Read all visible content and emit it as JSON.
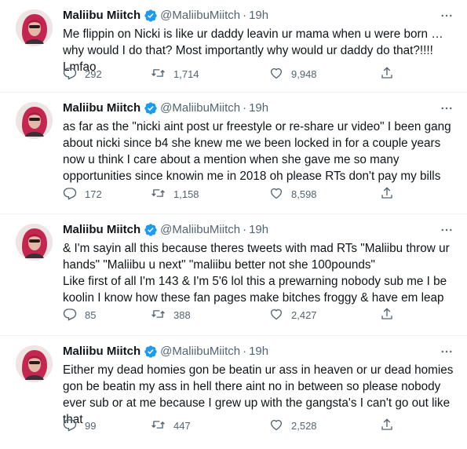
{
  "tweets": [
    {
      "name": "Maliibu Miitch",
      "handle": "@MaliibuMiitch",
      "dot": "·",
      "time": "19h",
      "text": "Me flippin on Nicki is like ur daddy leavin ur mama when u were born … why would I do that? Most importantly why would ur daddy do that?!!!! Lmfao",
      "replies": "292",
      "retweets": "1,714",
      "likes": "9,948"
    },
    {
      "name": "Maliibu Miitch",
      "handle": "@MaliibuMiitch",
      "dot": "·",
      "time": "19h",
      "text": "as far as the \"nicki aint post ur freestyle or re-share ur video\" I been gang about nicki since b4 she knew me we been locked in for a couple years now u think I care about a mention when she gave me so many opportunities since knowin me in 2018 oh please RTs don't pay my bills",
      "replies": "172",
      "retweets": "1,158",
      "likes": "8,598"
    },
    {
      "name": "Maliibu Miitch",
      "handle": "@MaliibuMiitch",
      "dot": "·",
      "time": "19h",
      "text": "& I'm sayin all this because theres tweets with mad RTs \"Maliibu throw ur hands\" \"Maliibu u next\" \"maliibu better not she 100pounds\"\nLike first of all I'm 143 & I'm 5'6 lol this a prewarning nobody sub me I be koolin I know how these fan pages make bitches froggy & have em leap",
      "replies": "85",
      "retweets": "388",
      "likes": "2,427"
    },
    {
      "name": "Maliibu Miitch",
      "handle": "@MaliibuMiitch",
      "dot": "·",
      "time": "19h",
      "text": "Either my dead homies gon be beatin ur ass in heaven or ur dead homies gon be beatin my ass in hell there aint no in between so please nobody ever sub or at me because I grew up with the gangsta's I can't go out like that",
      "replies": "99",
      "retweets": "447",
      "likes": "2,528"
    }
  ],
  "icons": {
    "verified": "verified-badge-icon",
    "more": "more-icon",
    "reply": "reply-icon",
    "retweet": "retweet-icon",
    "like": "like-icon",
    "share": "share-icon"
  },
  "colors": {
    "text": "#0f1419",
    "secondary": "#536471",
    "verified": "#1d9bf0",
    "divider": "#eff3f4"
  }
}
